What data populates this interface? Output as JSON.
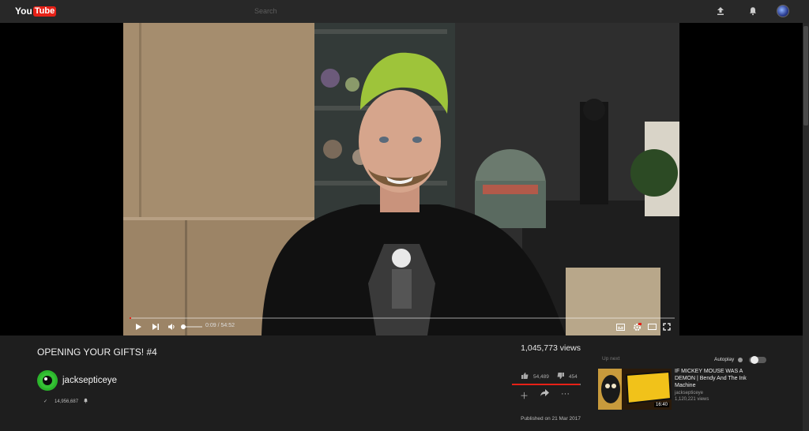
{
  "header": {
    "logo_you": "You",
    "logo_tube": "Tube",
    "search_placeholder": "Search"
  },
  "player": {
    "time_display": "0:09 / 54:52",
    "progress_fraction": 0.003,
    "volume_fraction": 0.0
  },
  "video": {
    "title": "OPENING YOUR GIFTS! #4",
    "views": "1,045,773 views",
    "likes": "54,489",
    "dislikes": "454",
    "like_fraction": 0.99,
    "published": "Published on 21 Mar 2017"
  },
  "channel": {
    "name": "jacksepticeye",
    "subscribers": "14,956,687"
  },
  "sidebar": {
    "up_next_label": "Up next",
    "autoplay_label": "Autoplay",
    "recommendations": [
      {
        "title": "IF MICKEY MOUSE WAS A DEMON | Bendy And The Ink Machine",
        "channel": "jacksepticeye",
        "views": "1,120,221 views",
        "duration": "16:40"
      }
    ]
  },
  "colors": {
    "brand_red": "#e62117",
    "topbar": "#282828",
    "page_bg": "#1e1e1e"
  }
}
